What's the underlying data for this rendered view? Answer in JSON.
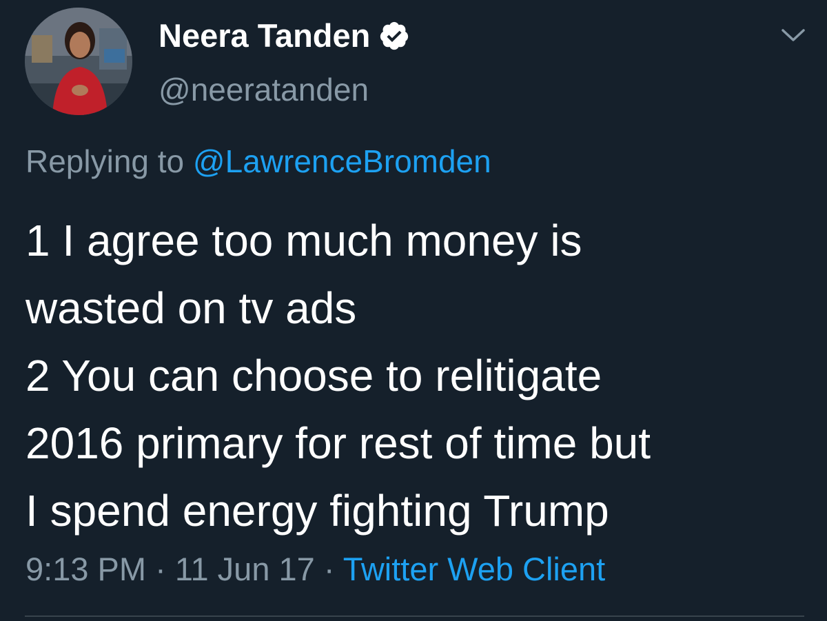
{
  "author": {
    "display_name": "Neera Tanden",
    "handle": "@neeratanden",
    "verified_icon": "verified-badge-icon"
  },
  "reply": {
    "prefix": "Replying to",
    "to_handle": "@LawrenceBromden"
  },
  "tweet": {
    "lines": [
      "1 I agree too much money is",
      "wasted on tv ads",
      "2 You can choose to relitigate",
      "2016 primary for rest of time but",
      "I spend energy fighting Trump"
    ]
  },
  "meta": {
    "time": "9:13 PM",
    "separator_1": " · ",
    "date": "11 Jun 17",
    "separator_2": " · ",
    "source": "Twitter Web Client"
  },
  "icons": {
    "more": "chevron-down-icon"
  },
  "colors": {
    "background": "#15202b",
    "text": "#ffffff",
    "secondary_text": "#8899a6",
    "link": "#1da1f2",
    "divider": "#38444d"
  }
}
